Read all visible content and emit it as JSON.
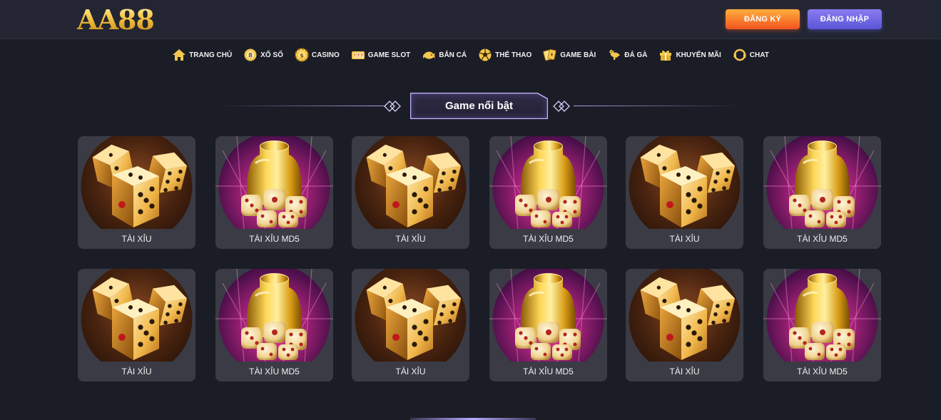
{
  "header": {
    "logo": "AA88",
    "register_label": "ĐĂNG KÝ",
    "login_label": "ĐĂNG NHẬP"
  },
  "nav": {
    "items": [
      {
        "label": "TRANG CHỦ",
        "icon": "home-icon"
      },
      {
        "label": "XỔ SỐ",
        "icon": "lottery-ball-icon"
      },
      {
        "label": "CASINO",
        "icon": "casino-chip-icon"
      },
      {
        "label": "GAME SLOT",
        "icon": "slot-machine-icon"
      },
      {
        "label": "BẮN CÁ",
        "icon": "fish-icon"
      },
      {
        "label": "THỂ THAO",
        "icon": "soccer-ball-icon"
      },
      {
        "label": "GAME BÀI",
        "icon": "playing-cards-icon"
      },
      {
        "label": "ĐÁ GÀ",
        "icon": "rooster-icon"
      },
      {
        "label": "KHUYẾN MÃI",
        "icon": "gift-icon"
      },
      {
        "label": "CHAT",
        "icon": "chat-icon"
      }
    ]
  },
  "section": {
    "title": "Game nổi bật"
  },
  "games": [
    {
      "label": "TÀI XỈU",
      "image": "dice-image"
    },
    {
      "label": "TÀI XỈU MD5",
      "image": "golden-cup-dice-image"
    },
    {
      "label": "TÀI XỈU",
      "image": "dice-image"
    },
    {
      "label": "TÀI XỈU MD5",
      "image": "golden-cup-dice-image"
    },
    {
      "label": "TÀI XỈU",
      "image": "dice-image"
    },
    {
      "label": "TÀI XỈU MD5",
      "image": "golden-cup-dice-image"
    },
    {
      "label": "TÀI XỈU",
      "image": "dice-image"
    },
    {
      "label": "TÀI XỈU MD5",
      "image": "golden-cup-dice-image"
    },
    {
      "label": "TÀI XỈU",
      "image": "dice-image"
    },
    {
      "label": "TÀI XỈU MD5",
      "image": "golden-cup-dice-image"
    },
    {
      "label": "TÀI XỈU",
      "image": "dice-image"
    },
    {
      "label": "TÀI XỈU MD5",
      "image": "golden-cup-dice-image"
    }
  ],
  "colors": {
    "background": "#1b1d26",
    "header": "#232632",
    "register_button": "#f2541f",
    "login_button": "#5a55d6",
    "accent_purple": "#b9a7ff",
    "gold": "#f6c544"
  }
}
